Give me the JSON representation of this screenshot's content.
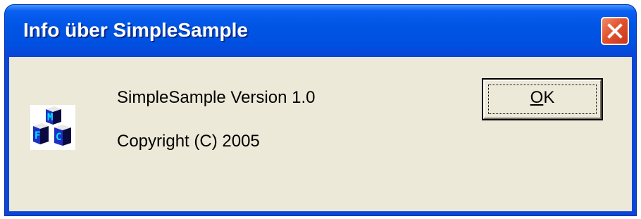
{
  "window": {
    "title": "Info über SimpleSample",
    "close_icon": "close-x-icon"
  },
  "content": {
    "app_icon": "mfc-cubes-icon",
    "version_text": "SimpleSample Version 1.0",
    "copyright_text": "Copyright (C) 2005"
  },
  "buttons": {
    "ok": {
      "mnemonic": "O",
      "rest": "K"
    }
  },
  "colors": {
    "titlebar": "#0055e5",
    "dialog_face": "#ece9d8",
    "close_button": "#e2532e"
  }
}
